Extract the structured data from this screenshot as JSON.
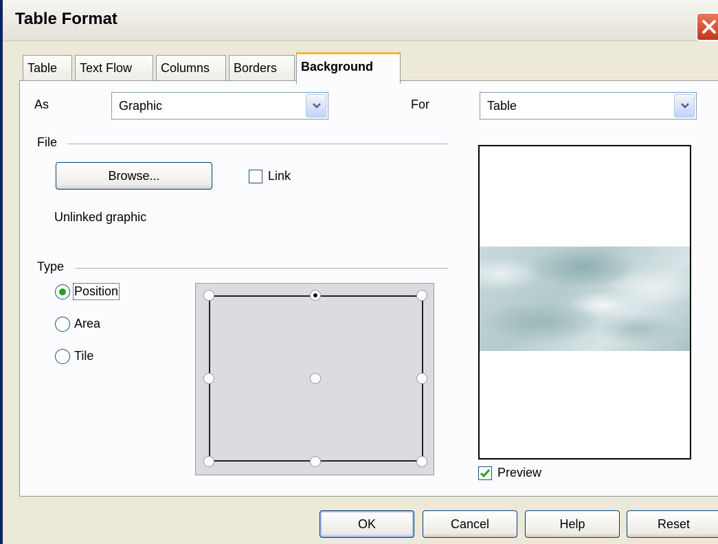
{
  "window": {
    "title": "Table Format"
  },
  "tabs": [
    {
      "label": "Table"
    },
    {
      "label": "Text Flow"
    },
    {
      "label": "Columns"
    },
    {
      "label": "Borders"
    },
    {
      "label": "Background",
      "active": true
    }
  ],
  "as_label": "As",
  "as_value": "Graphic",
  "for_label": "For",
  "for_value": "Table",
  "file_section": {
    "title": "File",
    "browse_label": "Browse...",
    "link_label": "Link",
    "link_checked": false,
    "status_text": "Unlinked graphic"
  },
  "type_section": {
    "title": "Type",
    "options": [
      {
        "label": "Position",
        "selected": true
      },
      {
        "label": "Area",
        "selected": false
      },
      {
        "label": "Tile",
        "selected": false
      }
    ]
  },
  "position_grid": {
    "selected": "top-center"
  },
  "preview": {
    "label": "Preview",
    "checked": true
  },
  "buttons": {
    "ok": "OK",
    "cancel": "Cancel",
    "help": "Help",
    "reset": "Reset"
  },
  "colors": {
    "dialog_bg": "#ece9d8",
    "panel_bg": "#fcfcfe",
    "active_tab_accent": "#f6b63c",
    "close_red": "#c5361b"
  }
}
